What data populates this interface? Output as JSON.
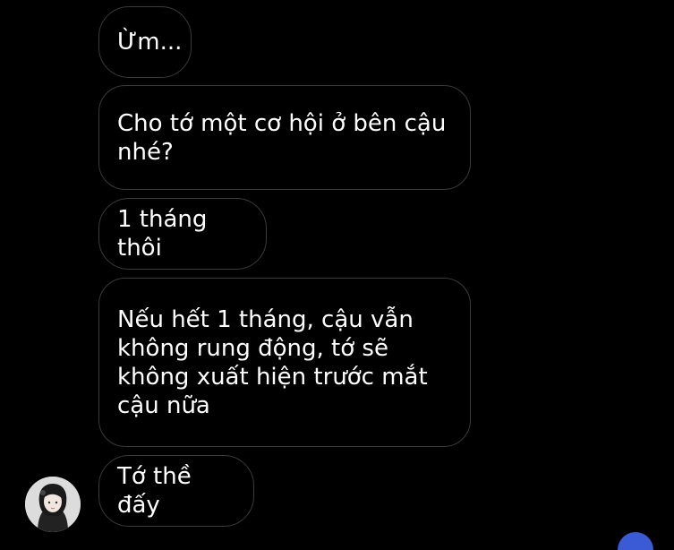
{
  "messages": [
    {
      "text": "Ừm..."
    },
    {
      "text": "Cho tớ một cơ hội ở bên cậu\nnhé?"
    },
    {
      "text": "1 tháng thôi"
    },
    {
      "text": "Nếu hết 1 tháng, cậu vẫn\nkhông rung động, tớ sẽ\nkhông xuất hiện trước mắt\ncậu nữa"
    },
    {
      "text": "Tớ thề đấy"
    }
  ],
  "icons": {
    "avatar": "contact-avatar-icon",
    "corner": "partial-badge-icon"
  },
  "colors": {
    "background": "#000000",
    "bubble_border": "#3a3a3a",
    "text": "#ffffff",
    "badge": "#3b5bd6"
  }
}
